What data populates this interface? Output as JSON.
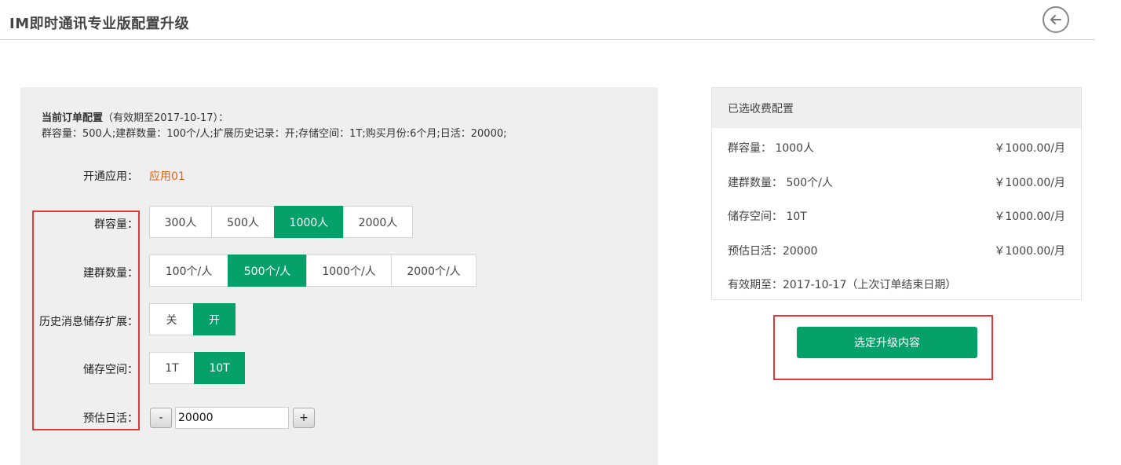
{
  "header": {
    "title": "IM即时通讯专业版配置升级"
  },
  "current_order": {
    "label_bold": "当前订单配置",
    "label_rest": "（有效期至2017-10-17）：",
    "details": "群容量：500人;建群数量：100个/人;扩展历史记录：开;存储空间：1T;购买月份:6个月;日活：20000;"
  },
  "form": {
    "app": {
      "label": "开通应用：",
      "value": "应用01"
    },
    "group_capacity": {
      "label": "群容量：",
      "options": [
        "300人",
        "500人",
        "1000人",
        "2000人"
      ],
      "selected": "1000人"
    },
    "group_count": {
      "label": "建群数量：",
      "options": [
        "100个/人",
        "500个/人",
        "1000个/人",
        "2000个/人"
      ],
      "selected": "500个/人"
    },
    "history": {
      "label": "历史消息储存扩展：",
      "options": [
        "关",
        "开"
      ],
      "selected": "开"
    },
    "storage": {
      "label": "储存空间：",
      "options": [
        "1T",
        "10T"
      ],
      "selected": "10T"
    },
    "daily_active": {
      "label": "预估日活：",
      "minus": "-",
      "plus": "+",
      "value": "20000"
    }
  },
  "summary": {
    "title": "已选收费配置",
    "rows": [
      {
        "label": "群容量： 1000人",
        "price": "￥1000.00/月"
      },
      {
        "label": "建群数量： 500个/人",
        "price": "￥1000.00/月"
      },
      {
        "label": "储存空间： 10T",
        "price": "￥1000.00/月"
      },
      {
        "label": "预估日活：20000",
        "price": "￥1000.00/月"
      }
    ],
    "validity": "有效期至：2017-10-17（上次订单结束日期）"
  },
  "actions": {
    "confirm_label": "选定升级内容"
  },
  "colors": {
    "accent_green": "#06a06b",
    "highlight_red": "#e53935",
    "app_orange": "#e8600c"
  }
}
